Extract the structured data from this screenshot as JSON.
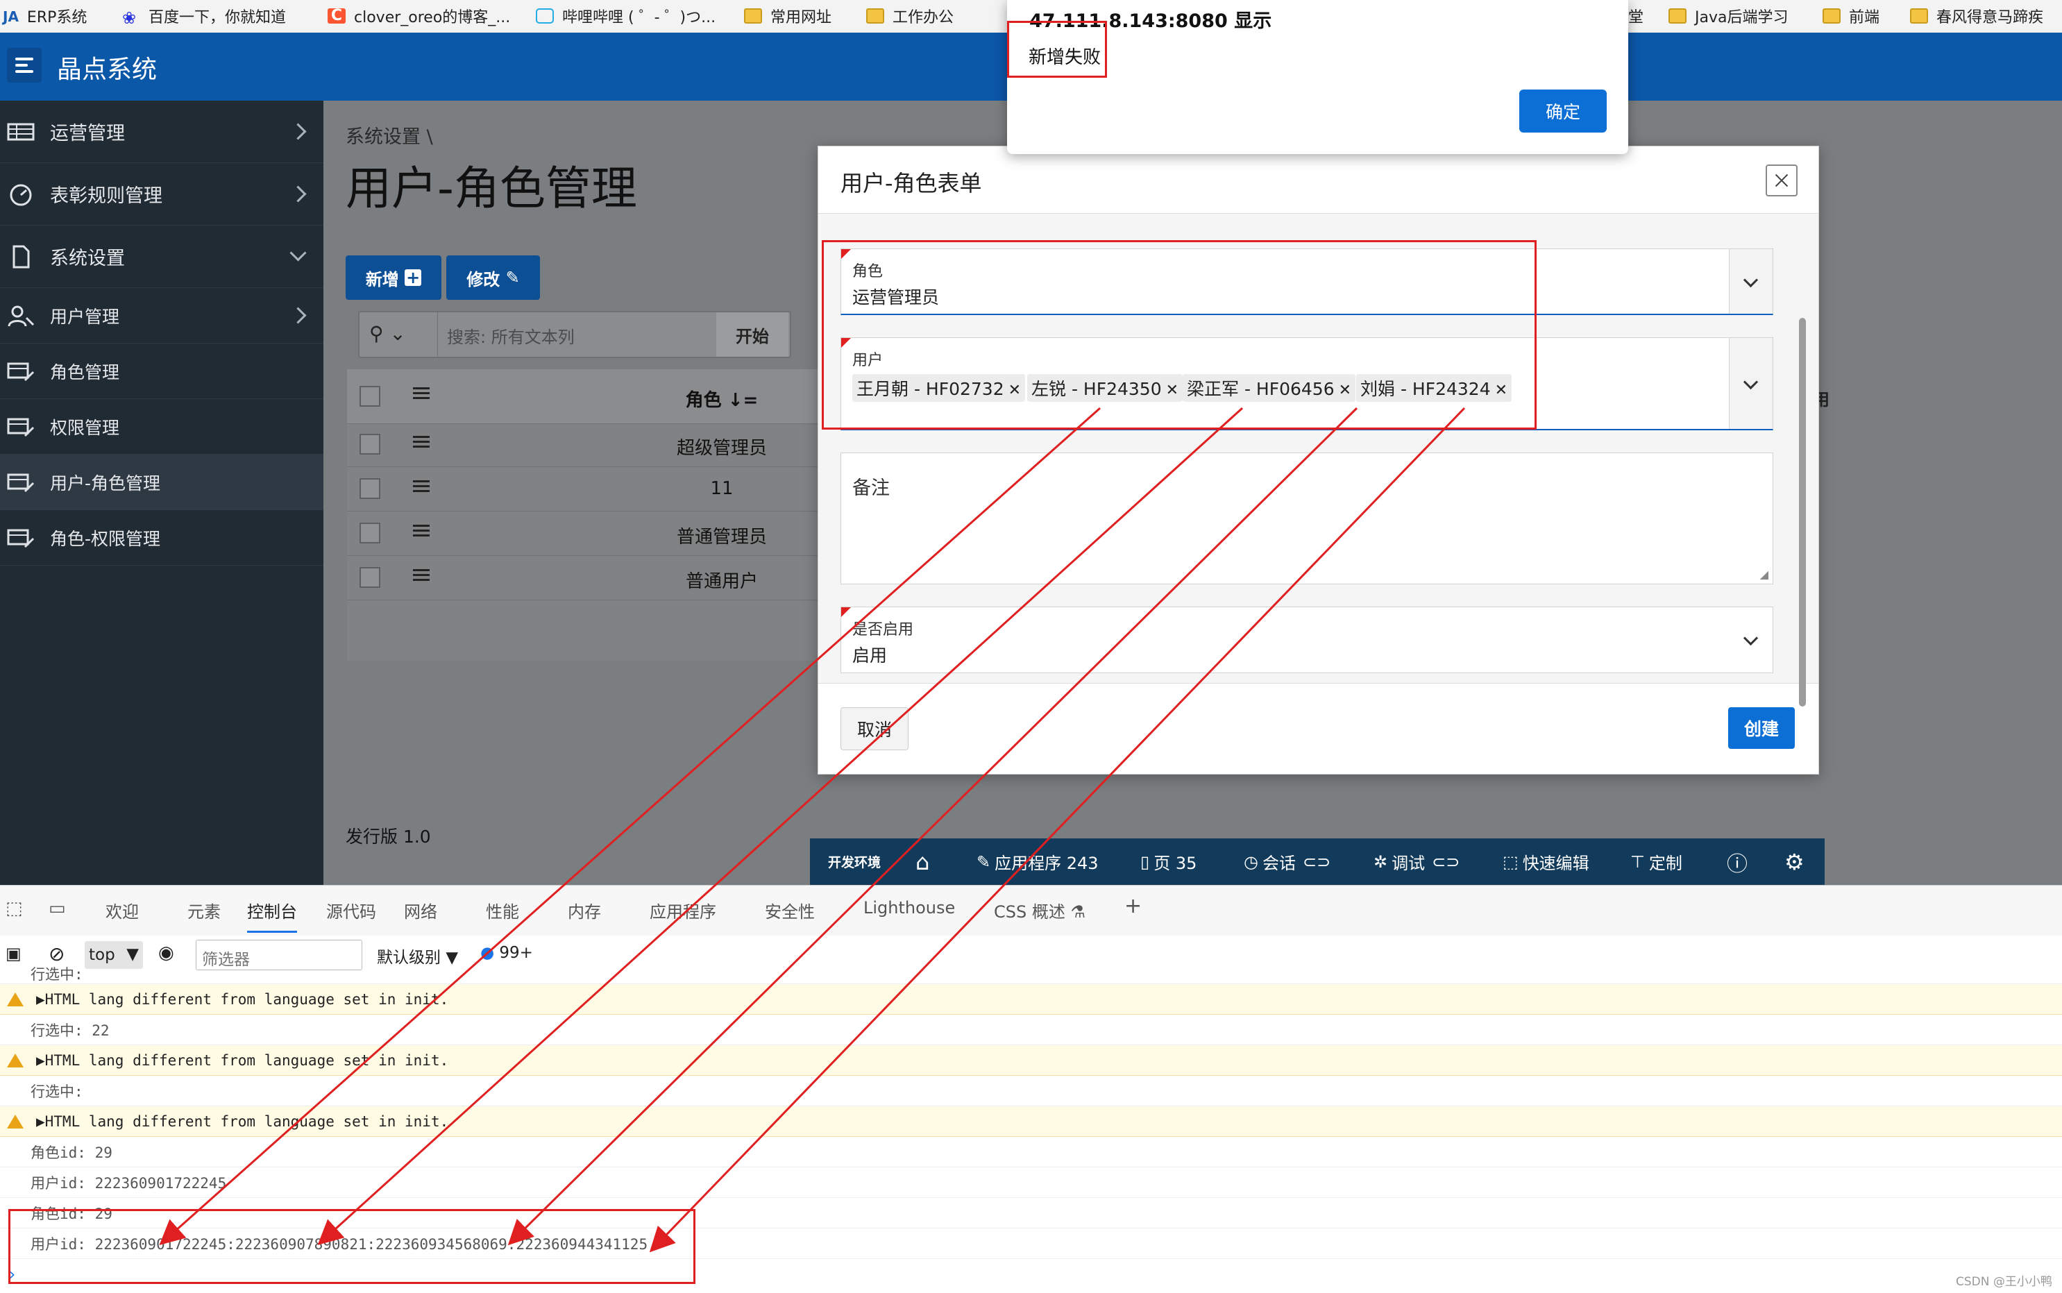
{
  "bookmarks": [
    {
      "label": "ERP系统",
      "icon": "ja-icon"
    },
    {
      "label": "百度一下，你就知道",
      "icon": "baidu-paw-icon"
    },
    {
      "label": "clover_oreo的博客_...",
      "icon": "csdn-c-icon"
    },
    {
      "label": "哔哩哔哩 ( ゜- ゜)つ...",
      "icon": "bilibili-icon"
    },
    {
      "label": "常用网址",
      "icon": "folder-icon"
    },
    {
      "label": "工作办公",
      "icon": "folder-icon"
    },
    {
      "label": "堂",
      "icon": ""
    },
    {
      "label": "Java后端学习",
      "icon": "folder-icon"
    },
    {
      "label": "前端",
      "icon": "folder-icon"
    },
    {
      "label": "春风得意马蹄疾",
      "icon": "folder-icon"
    }
  ],
  "header": {
    "app_name": "晶点系统"
  },
  "sidebar": {
    "items": [
      {
        "label": "运营管理",
        "icon": "table-icon",
        "chevron": "right"
      },
      {
        "label": "表彰规则管理",
        "icon": "gauge-icon",
        "chevron": "right"
      },
      {
        "label": "系统设置",
        "icon": "file-icon",
        "chevron": "down"
      },
      {
        "label": "用户管理",
        "icon": "user-key-icon",
        "chevron": "right"
      },
      {
        "label": "角色管理",
        "icon": "table-edit-icon",
        "chevron": ""
      },
      {
        "label": "权限管理",
        "icon": "table-edit-icon",
        "chevron": ""
      },
      {
        "label": "用户-角色管理",
        "icon": "table-edit-icon",
        "chevron": "",
        "active": true
      },
      {
        "label": "角色-权限管理",
        "icon": "table-edit-icon",
        "chevron": ""
      }
    ]
  },
  "page": {
    "breadcrumb": "系统设置",
    "title": "用户-角色管理",
    "add_button": "新增",
    "edit_button": "修改",
    "search_placeholder": "搜索: 所有文本列",
    "search_go": "开始",
    "grid": {
      "col_role": "角色",
      "col_enabled_partial": "用",
      "rows": [
        "超级管理员",
        "11",
        "普通管理员",
        "普通用户"
      ]
    },
    "release": "发行版 1.0"
  },
  "dev_toolbar": {
    "env": "开发环境",
    "app": "应用程序 243",
    "page": "页 35",
    "session": "会话",
    "debug": "调试",
    "quick_edit": "快速编辑",
    "customize": "定制"
  },
  "dialog": {
    "title": "用户-角色表单",
    "role_label": "角色",
    "role_value": "运营管理员",
    "user_label": "用户",
    "users": [
      "王月朝 - HF02732",
      "左锐 - HF24350",
      "梁正军 - HF06456",
      "刘娟 - HF24324"
    ],
    "remark_label": "备注",
    "enabled_label": "是否启用",
    "enabled_value": "启用",
    "cancel": "取消",
    "create": "创建"
  },
  "alert": {
    "origin": "47.111.8.143:8080 显示",
    "message": "新增失败",
    "ok": "确定"
  },
  "devtools": {
    "tabs": [
      "欢迎",
      "元素",
      "控制台",
      "源代码",
      "网络",
      "性能",
      "内存",
      "应用程序",
      "安全性",
      "Lighthouse",
      "CSS 概述 ⚗",
      "+"
    ],
    "context": "top",
    "filter_placeholder": "筛选器",
    "level": "默认级别",
    "issues": "99+",
    "console": [
      {
        "type": "log",
        "text": "行选中:"
      },
      {
        "type": "warn",
        "text": "▶HTML lang different from language set in init."
      },
      {
        "type": "log",
        "text": "行选中: 22"
      },
      {
        "type": "warn",
        "text": "▶HTML lang different from language set in init."
      },
      {
        "type": "log",
        "text": "行选中:"
      },
      {
        "type": "warn",
        "text": "▶HTML lang different from language set in init."
      },
      {
        "type": "log",
        "text": "角色id: 29"
      },
      {
        "type": "log",
        "text": "用户id: 222360901722245"
      },
      {
        "type": "log",
        "text": "角色id: 29"
      },
      {
        "type": "log",
        "text": "用户id: 222360901722245:222360907890821:222360934568069:222360944341125"
      }
    ],
    "prompt": "›"
  },
  "watermark": "CSDN @王小小鸭",
  "colors": {
    "header": "#0b57a8",
    "sidebar": "#212b33",
    "primary_button": "#0b6fd6",
    "annotation": "#e02020"
  }
}
